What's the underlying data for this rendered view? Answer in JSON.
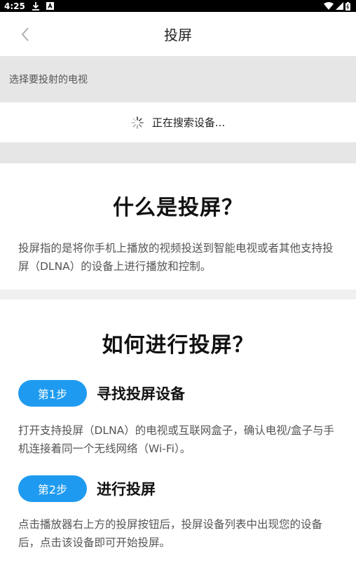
{
  "status_bar": {
    "time": "4:25"
  },
  "app_bar": {
    "title": "投屏"
  },
  "section": {
    "header": "选择要投射的电视",
    "searching_text": "正在搜索设备..."
  },
  "what": {
    "title": "什么是投屏？",
    "body": "投屏指的是将你手机上播放的视频投送到智能电视或者其他支持投屏（DLNA）的设备上进行播放和控制。"
  },
  "how": {
    "title": "如何进行投屏？",
    "steps": [
      {
        "badge": "第1步",
        "title": "寻找投屏设备",
        "body": "打开支持投屏（DLNA）的电视或互联网盒子，确认电视/盒子与手机连接着同一个无线网络（Wi-Fi）。"
      },
      {
        "badge": "第2步",
        "title": "进行投屏",
        "body": "点击播放器右上方的投屏按钮后，投屏设备列表中出现您的设备后，点击该设备即可开始投屏。"
      }
    ]
  },
  "colors": {
    "accent": "#1e9bf0",
    "status_bar": "#000000"
  }
}
